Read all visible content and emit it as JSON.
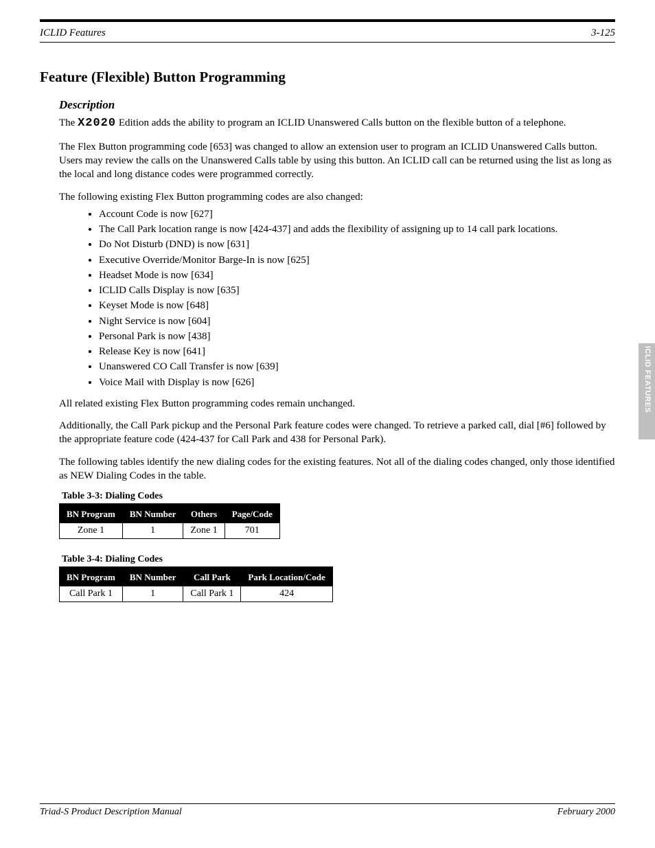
{
  "header": {
    "left": "ICLID Features",
    "right": "3-125"
  },
  "title": "Feature (Flexible) Button Programming",
  "desc": {
    "heading": "Description",
    "p1_a": "The ",
    "p1_mono": "X2020",
    "p1_b": " Edition adds the ability to program an ICLID Unanswered Calls button on the flexible button of a telephone.",
    "p2": "The Flex Button programming code [653] was changed to allow an extension user to program an ICLID Unanswered Calls button. Users may review the calls on the Unanswered Calls table by using this button. An ICLID call can be returned using the list as long as the local and long distance codes were programmed correctly.",
    "p3": "The following existing Flex Button programming codes are also changed:",
    "bullets": [
      "Account Code is now [627]",
      "The Call Park location range is now [424-437] and adds the flexibility of assigning up to 14 call park locations.",
      "Do Not Disturb (DND) is now [631]",
      "Executive Override/Monitor Barge-In is now [625]",
      "Headset Mode is now [634]",
      "ICLID Calls Display is now [635]",
      "Keyset Mode is now [648]",
      "Night Service is now [604]",
      "Personal Park is now [438]",
      "Release Key is now [641]",
      "Unanswered CO Call Transfer is now [639]",
      "Voice Mail with Display is now [626]"
    ],
    "p4": "All related existing Flex Button programming codes remain unchanged.",
    "p5": "Additionally, the Call Park pickup and the Personal Park feature codes were changed. To retrieve a parked call, dial [#6] followed by the appropriate feature code (424-437 for Call Park and 438 for Personal Park).",
    "p6": "The following tables identify the new dialing codes for the existing features. Not all of the dialing codes changed, only those identified as NEW Dialing Codes in the table."
  },
  "table1": {
    "caption_label": "Table 3-3: ",
    "caption_text": "Dialing Codes",
    "headers": [
      "BN Program",
      "BN Number",
      "Others",
      "Page/Code"
    ],
    "rows": [
      [
        "Zone 1",
        "1",
        "Zone 1",
        "701"
      ]
    ]
  },
  "table2": {
    "caption_label": "Table 3-4: ",
    "caption_text": "Dialing Codes",
    "headers": [
      "BN Program",
      "BN Number",
      "Call Park",
      "Park Location/Code"
    ],
    "rows": [
      [
        "Call Park 1",
        "1",
        "Call Park 1",
        "424"
      ]
    ]
  },
  "sidetab": "ICLID FEATURES",
  "footer": {
    "left": "Triad-S Product Description Manual",
    "right": "February 2000"
  }
}
